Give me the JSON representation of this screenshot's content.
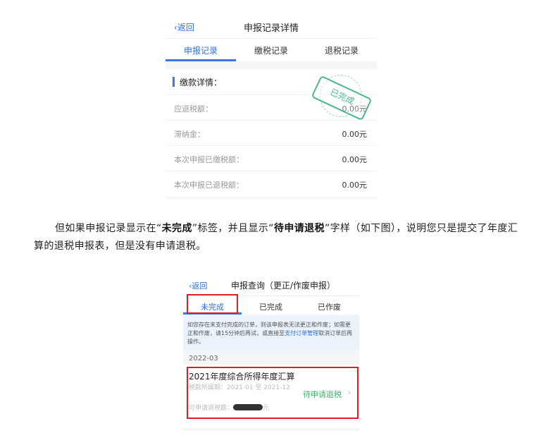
{
  "shot1": {
    "back_label": "返回",
    "title": "申报记录详情",
    "tabs": [
      {
        "label": "申报记录",
        "active": true
      },
      {
        "label": "缴税记录",
        "active": false
      },
      {
        "label": "退税记录",
        "active": false
      }
    ],
    "section_title": "缴款详情：",
    "rows": [
      {
        "label": "应退税额：",
        "value": "0.00元"
      },
      {
        "label": "滞纳金：",
        "value": "0.00元"
      },
      {
        "label": "本次申报已缴税额：",
        "value": "0.00元"
      },
      {
        "label": "本次申报已退税额：",
        "value": "0.00元"
      }
    ],
    "stamp_text": "已完成",
    "colors": {
      "accent": "#3b7be0",
      "stamp": "#4cb888"
    }
  },
  "paragraph": {
    "part1": "但如果申报记录显示在“",
    "bold1": "未完成",
    "part2": "”标签，并且显示“",
    "bold2": "待申请退税",
    "part3": "”字样（如下图），说明您只是提交了年度汇算的退税申报表，但是没有申请退税。"
  },
  "shot2": {
    "back_label": "返回",
    "title": "申报查询（更正/作废申报）",
    "tabs": [
      {
        "label": "未完成",
        "active": true
      },
      {
        "label": "已完成",
        "active": false
      },
      {
        "label": "已作废",
        "active": false
      }
    ],
    "notice_text": "如您存在未支付完成的订单，则该申报表无法更正和作废；如需更正和作废，请15分钟后再试，或直接至",
    "notice_link": "支付订单管理",
    "notice_tail": "取消订单后再操作。",
    "date": "2022-03",
    "card": {
      "title": "2021年度综合所得年度汇算",
      "period": "税款所属期：2021-01 至 2021-12",
      "amount_label": "可申请退税额：",
      "amount_suffix": "元",
      "status": "待申请退税"
    },
    "colors": {
      "highlight": "#e02020",
      "status": "#3fae6f"
    }
  }
}
